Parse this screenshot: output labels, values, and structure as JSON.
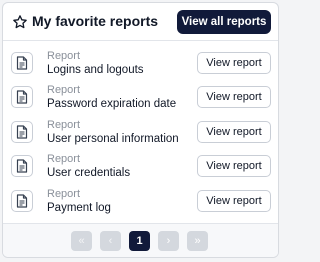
{
  "header": {
    "title": "My favorite reports",
    "view_all_label": "View all reports",
    "icon": "star-icon"
  },
  "reports": [
    {
      "kind": "Report",
      "name": "Logins and logouts",
      "action": "View report",
      "icon": "document-icon"
    },
    {
      "kind": "Report",
      "name": "Password expiration date",
      "action": "View report",
      "icon": "document-icon"
    },
    {
      "kind": "Report",
      "name": "User personal information",
      "action": "View report",
      "icon": "document-icon"
    },
    {
      "kind": "Report",
      "name": "User credentials",
      "action": "View report",
      "icon": "document-icon"
    },
    {
      "kind": "Report",
      "name": "Payment log",
      "action": "View report",
      "icon": "document-icon"
    }
  ],
  "pagination": {
    "first": "«",
    "prev": "‹",
    "current": "1",
    "next": "›",
    "last": "»"
  },
  "colors": {
    "primary": "#111a3a",
    "border": "#c9ced6",
    "muted_text": "#8a909a",
    "disabled": "#d4d8de"
  }
}
